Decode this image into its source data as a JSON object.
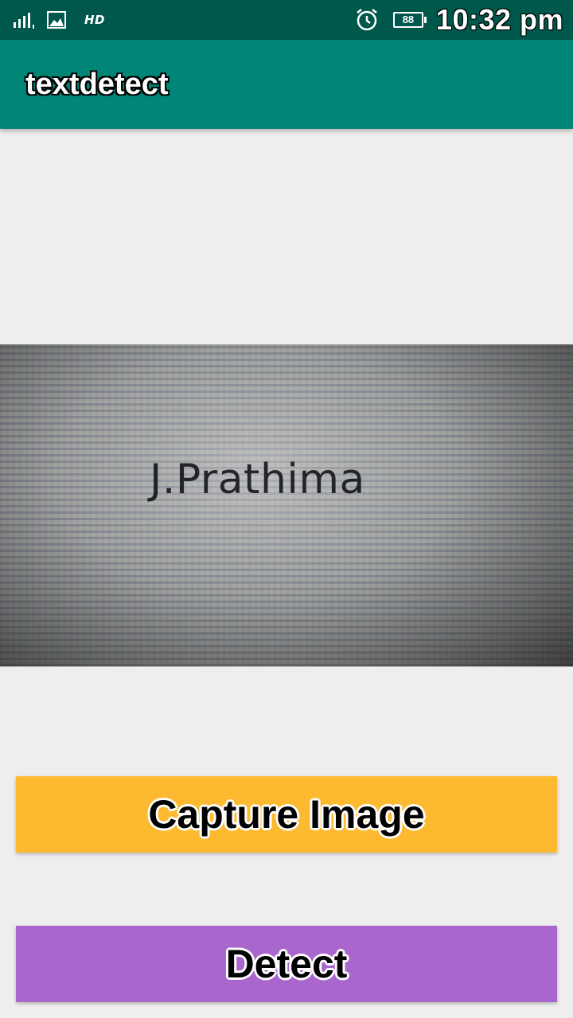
{
  "status_bar": {
    "network_label": "HD",
    "battery_level": "88",
    "time": "10:32 pm",
    "icons": [
      "signal-icon",
      "gallery-icon",
      "alarm-icon",
      "battery-icon"
    ]
  },
  "app_bar": {
    "title": "textdetect"
  },
  "preview": {
    "captured_text": "J.Prathima"
  },
  "buttons": {
    "capture_label": "Capture Image",
    "detect_label": "Detect"
  },
  "colors": {
    "status_bar": "#00574b",
    "app_bar": "#008577",
    "capture_button": "#fdba30",
    "detect_button": "#a966cd",
    "background": "#eeeeee"
  }
}
